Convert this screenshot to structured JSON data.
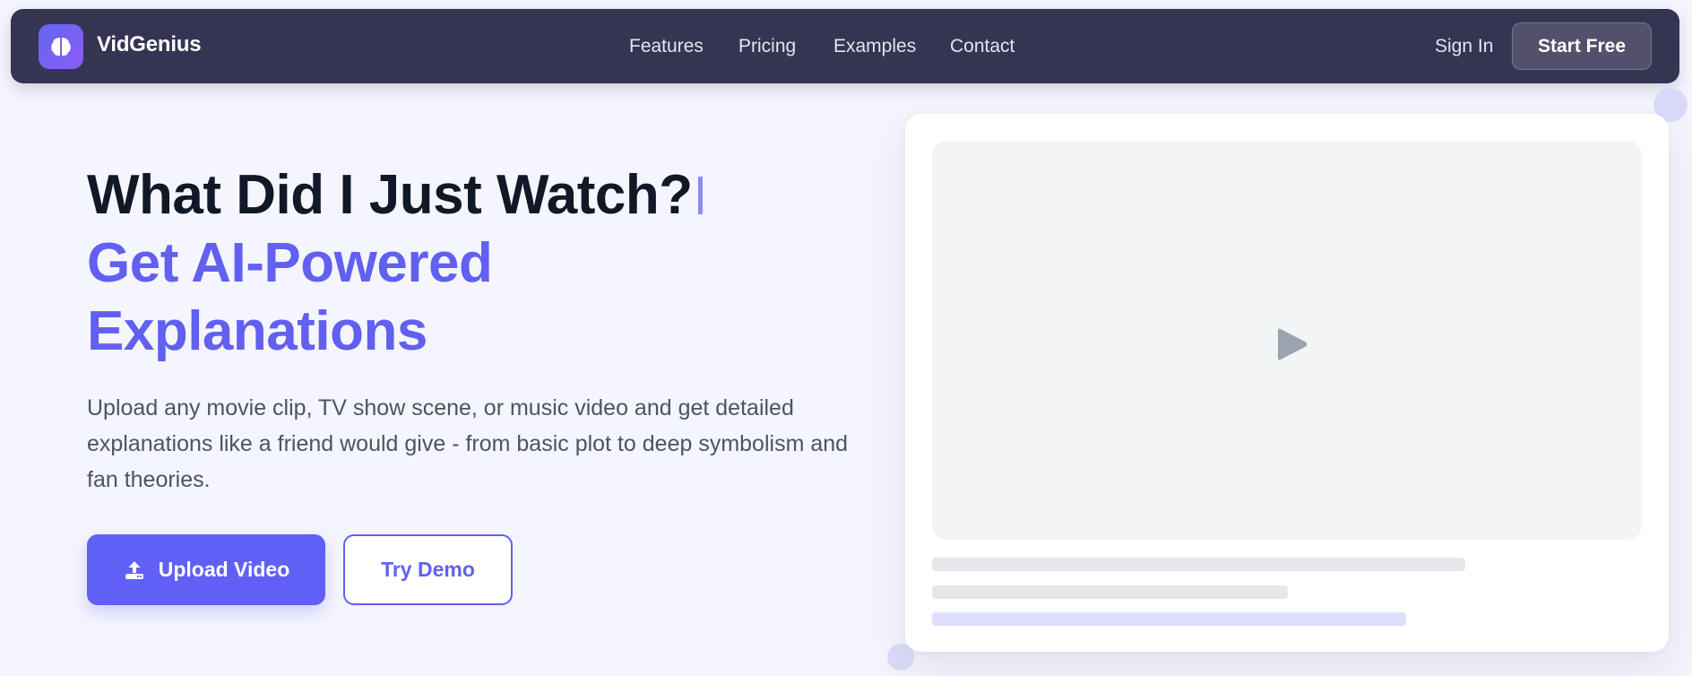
{
  "nav": {
    "brand": "VidGenius",
    "links": [
      "Features",
      "Pricing",
      "Examples",
      "Contact"
    ],
    "sign_in": "Sign In",
    "start_free": "Start Free"
  },
  "hero": {
    "headline_line1": "What Did I Just Watch?",
    "headline_highlight": "Get AI-Powered Explanations",
    "description": "Upload any movie clip, TV show scene, or music video and get detailed explanations like a friend would give - from basic plot to deep symbolism and fan theories.",
    "upload_button": "Upload Video",
    "demo_button": "Try Demo"
  },
  "preview": {
    "play_icon": "play-icon"
  },
  "colors": {
    "accent": "#6160f0",
    "nav_bg": "#363453",
    "page_bg": "#f5f5fd",
    "heading": "#111827"
  }
}
